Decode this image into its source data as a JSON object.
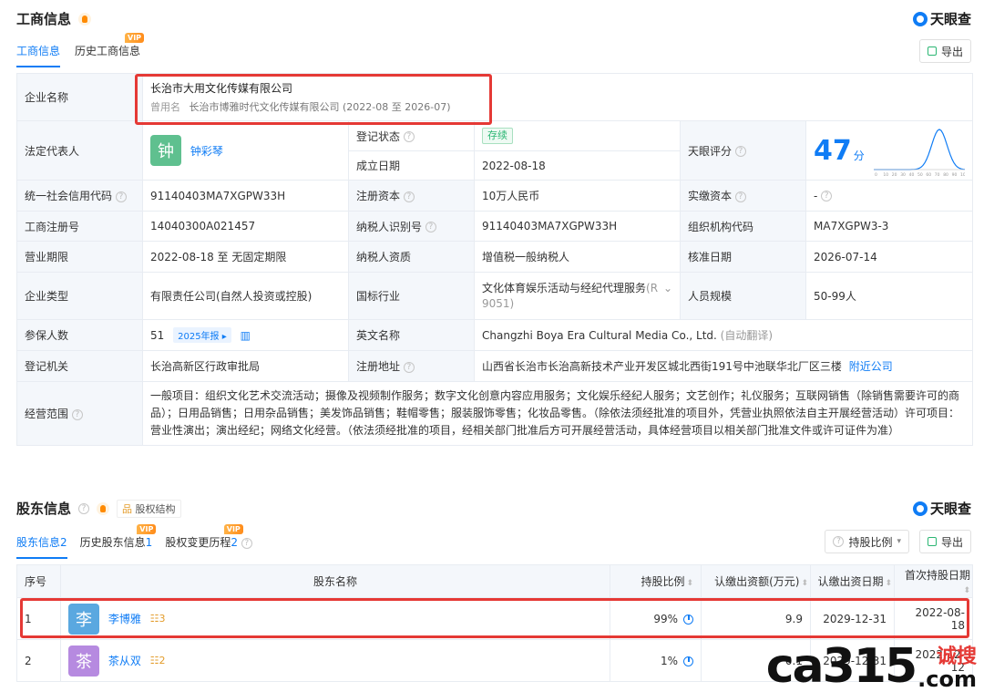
{
  "business": {
    "title": "工商信息",
    "brand": "天眼查",
    "tabs": [
      {
        "label": "工商信息",
        "active": true
      },
      {
        "label": "历史工商信息",
        "vip": "VIP"
      }
    ],
    "export_label": "导出",
    "company_name_label": "企业名称",
    "company_name": "长治市大用文化传媒有限公司",
    "former_name_tag": "曾用名",
    "former_name": "长治市博雅时代文化传媒有限公司 (2022-08 至 2026-07)",
    "legal_rep_label": "法定代表人",
    "legal_rep_avatar": "钟",
    "legal_rep": "钟彩琴",
    "reg_status_label": "登记状态",
    "reg_status": "存续",
    "found_date_label": "成立日期",
    "found_date": "2022-08-18",
    "score_label": "天眼评分",
    "score": "47",
    "score_unit": "分",
    "rows": [
      {
        "l1": "统一社会信用代码",
        "v1": "91140403MA7XGPW33H",
        "l2": "注册资本",
        "v2": "10万人民币",
        "l3": "实缴资本",
        "v3": "-"
      },
      {
        "l1": "工商注册号",
        "v1": "14040300A021457",
        "l2": "纳税人识别号",
        "v2": "91140403MA7XGPW33H",
        "l3": "组织机构代码",
        "v3": "MA7XGPW3-3"
      },
      {
        "l1": "营业期限",
        "v1": "2022-08-18 至 无固定期限",
        "l2": "纳税人资质",
        "v2": "增值税一般纳税人",
        "l3": "核准日期",
        "v3": "2026-07-14"
      },
      {
        "l1": "企业类型",
        "v1": "有限责任公司(自然人投资或控股)",
        "l2": "国标行业",
        "v2": "文化体育娱乐活动与经纪代理服务",
        "l3": "人员规模",
        "v3": "50-99人"
      }
    ],
    "industry_code": "(R 9051)",
    "insured_label": "参保人数",
    "insured_count": "51",
    "insured_chip": "2025年报",
    "english_name_label": "英文名称",
    "english_name": "Changzhi Boya Era Cultural Media Co., Ltd.",
    "auto_translate": "(自动翻译)",
    "authority_label": "登记机关",
    "authority": "长治高新区行政审批局",
    "address_label": "注册地址",
    "address": "山西省长治市长治高新技术产业开发区城北西街191号中池联华北厂区三楼",
    "nearby": "附近公司",
    "scope_label": "经营范围",
    "scope": "一般项目：组织文化艺术交流活动；摄像及视频制作服务；数字文化创意内容应用服务；文化娱乐经纪人服务；文艺创作；礼仪服务；互联网销售（除销售需要许可的商品）；日用品销售；日用杂品销售；美发饰品销售；鞋帽零售；服装服饰零售；化妆品零售。（除依法须经批准的项目外，凭营业执照依法自主开展经营活动）许可项目：营业性演出；演出经纪；网络文化经营。（依法须经批准的项目，经相关部门批准后方可开展经营活动，具体经营项目以相关部门批准文件或许可证件为准）"
  },
  "shareholders": {
    "title": "股东信息",
    "structure_link": "股权结构",
    "brand": "天眼查",
    "tabs": [
      {
        "label": "股东信息",
        "count": "2",
        "active": true
      },
      {
        "label": "历史股东信息",
        "count": "1",
        "vip": "VIP"
      },
      {
        "label": "股权变更历程",
        "count": "2",
        "vip": "VIP"
      }
    ],
    "ratio_button": "持股比例",
    "export_label": "导出",
    "columns": [
      "序号",
      "股东名称",
      "持股比例",
      "认缴出资额(万元)",
      "认缴出资日期",
      "首次持股日期"
    ],
    "rows": [
      {
        "index": "1",
        "avatar": "李",
        "name": "李博雅",
        "rel": "3",
        "ratio": "99%",
        "amount": "9.9",
        "due": "2029-12-31",
        "first": "2022-08-18"
      },
      {
        "index": "2",
        "avatar": "茶",
        "name": "茶从双",
        "rel": "2",
        "ratio": "1%",
        "amount": "0.1",
        "due": "2029-12-31",
        "first": "2022-12-12"
      }
    ]
  },
  "watermark": {
    "big": "ca315",
    "cn": "诚搜",
    "com": ".com"
  },
  "colors": {
    "accent": "#0f7cf5",
    "highlight": "#e53935",
    "legal_avatar": "#5fc08f",
    "holder1_avatar": "#5aa8e0",
    "holder2_avatar": "#b68ae0"
  },
  "score_curve": {
    "score": 47,
    "ticks": [
      "0",
      "10",
      "20",
      "30",
      "40",
      "50",
      "60",
      "70",
      "80",
      "90",
      "100"
    ]
  }
}
